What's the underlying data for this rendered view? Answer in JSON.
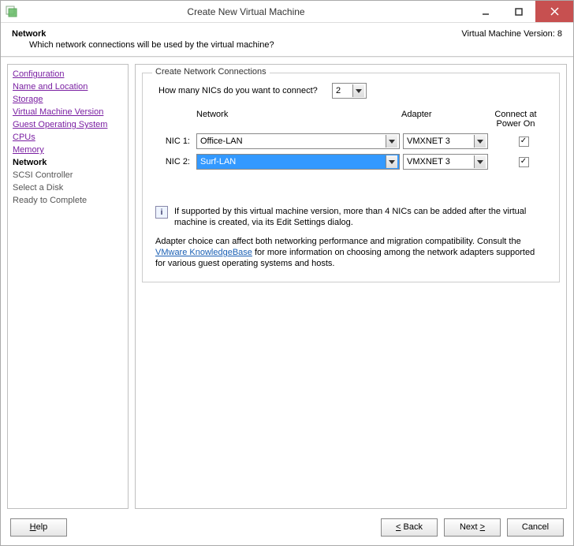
{
  "window": {
    "title": "Create New Virtual Machine"
  },
  "header": {
    "title": "Network",
    "subtitle": "Which network connections will be used by the virtual machine?",
    "version": "Virtual Machine Version: 8"
  },
  "sidebar": {
    "steps": [
      {
        "label": "Configuration",
        "state": "done"
      },
      {
        "label": "Name and Location",
        "state": "done"
      },
      {
        "label": "Storage",
        "state": "done"
      },
      {
        "label": "Virtual Machine Version",
        "state": "done"
      },
      {
        "label": "Guest Operating System",
        "state": "done"
      },
      {
        "label": "CPUs",
        "state": "done"
      },
      {
        "label": "Memory",
        "state": "done"
      },
      {
        "label": "Network",
        "state": "current"
      },
      {
        "label": "SCSI Controller",
        "state": "pending"
      },
      {
        "label": "Select a Disk",
        "state": "pending"
      },
      {
        "label": "Ready to Complete",
        "state": "pending"
      }
    ]
  },
  "fieldset": {
    "legend": "Create Network Connections",
    "question": "How many NICs do you want to connect?",
    "nic_count": "2",
    "columns": {
      "network": "Network",
      "adapter": "Adapter",
      "connect": "Connect at Power On"
    },
    "rows": [
      {
        "label": "NIC 1:",
        "network": "Office-LAN",
        "adapter": "VMXNET 3",
        "checked": true,
        "highlight": false
      },
      {
        "label": "NIC 2:",
        "network": "Surf-LAN",
        "adapter": "VMXNET 3",
        "checked": true,
        "highlight": true
      }
    ],
    "info": "If supported by this virtual machine version, more than 4 NICs can be added after the virtual machine is created, via its Edit Settings dialog.",
    "advice_pre": "Adapter choice can affect both networking performance and migration compatibility. Consult the ",
    "advice_link": "VMware KnowledgeBase",
    "advice_post": " for more information on choosing among the network adapters supported for various guest operating systems and hosts."
  },
  "footer": {
    "help": "Help",
    "back": "Back",
    "next": "Next",
    "cancel": "Cancel"
  }
}
